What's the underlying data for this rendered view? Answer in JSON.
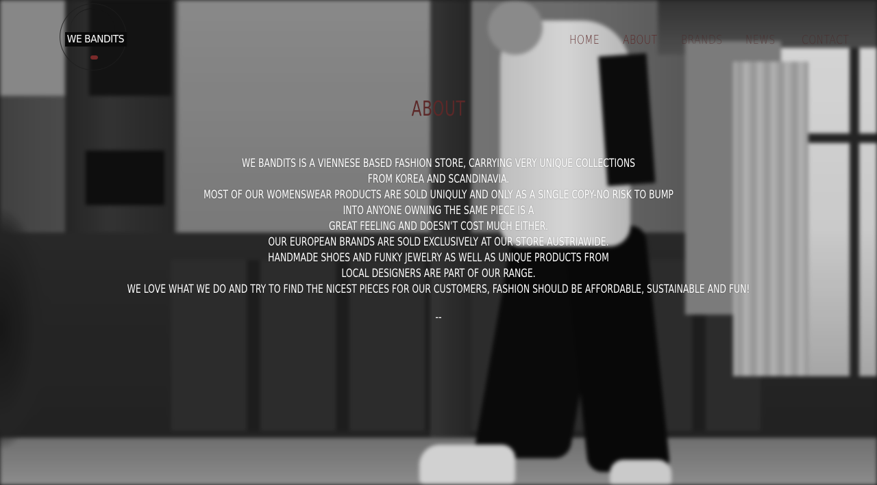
{
  "logo": {
    "text": "WE BANDITS"
  },
  "nav": {
    "items": [
      {
        "label": "HOME"
      },
      {
        "label": "ABOUT"
      },
      {
        "label": "BRANDS"
      },
      {
        "label": "NEWS"
      },
      {
        "label": "CONTACT"
      }
    ]
  },
  "main": {
    "title": "ABOUT",
    "lines": [
      "WE BANDITS IS A VIENNESE BASED FASHION STORE, CARRYING VERY UNIQUE COLLECTIONS",
      "FROM KOREA AND SCANDINAVIA.",
      "MOST OF OUR WOMENSWEAR PRODUCTS ARE SOLD UNIQULY AND ONLY AS A SINGLE COPY-NO RISK TO BUMP",
      "INTO ANYONE OWNING THE SAME PIECE IS A",
      "GREAT FEELING AND DOESN'T COST MUCH EITHER.",
      "OUR EUROPEAN BRANDS ARE SOLD EXCLUSIVELY AT OUR STORE AUSTRIAWIDE.",
      "HANDMADE SHOES AND FUNKY JEWELRY AS WELL AS UNIQUE PRODUCTS FROM",
      "LOCAL DESIGNERS ARE PART OF OUR RANGE.",
      "WE LOVE WHAT WE DO AND TRY TO FIND THE NICEST PIECES FOR OUR CUSTOMERS, FASHION SHOULD BE AFFORDABLE, SUSTAINABLE AND FUN!"
    ],
    "separator": "--"
  },
  "colors": {
    "accent": "#5c2828",
    "text": "#ffffff"
  }
}
